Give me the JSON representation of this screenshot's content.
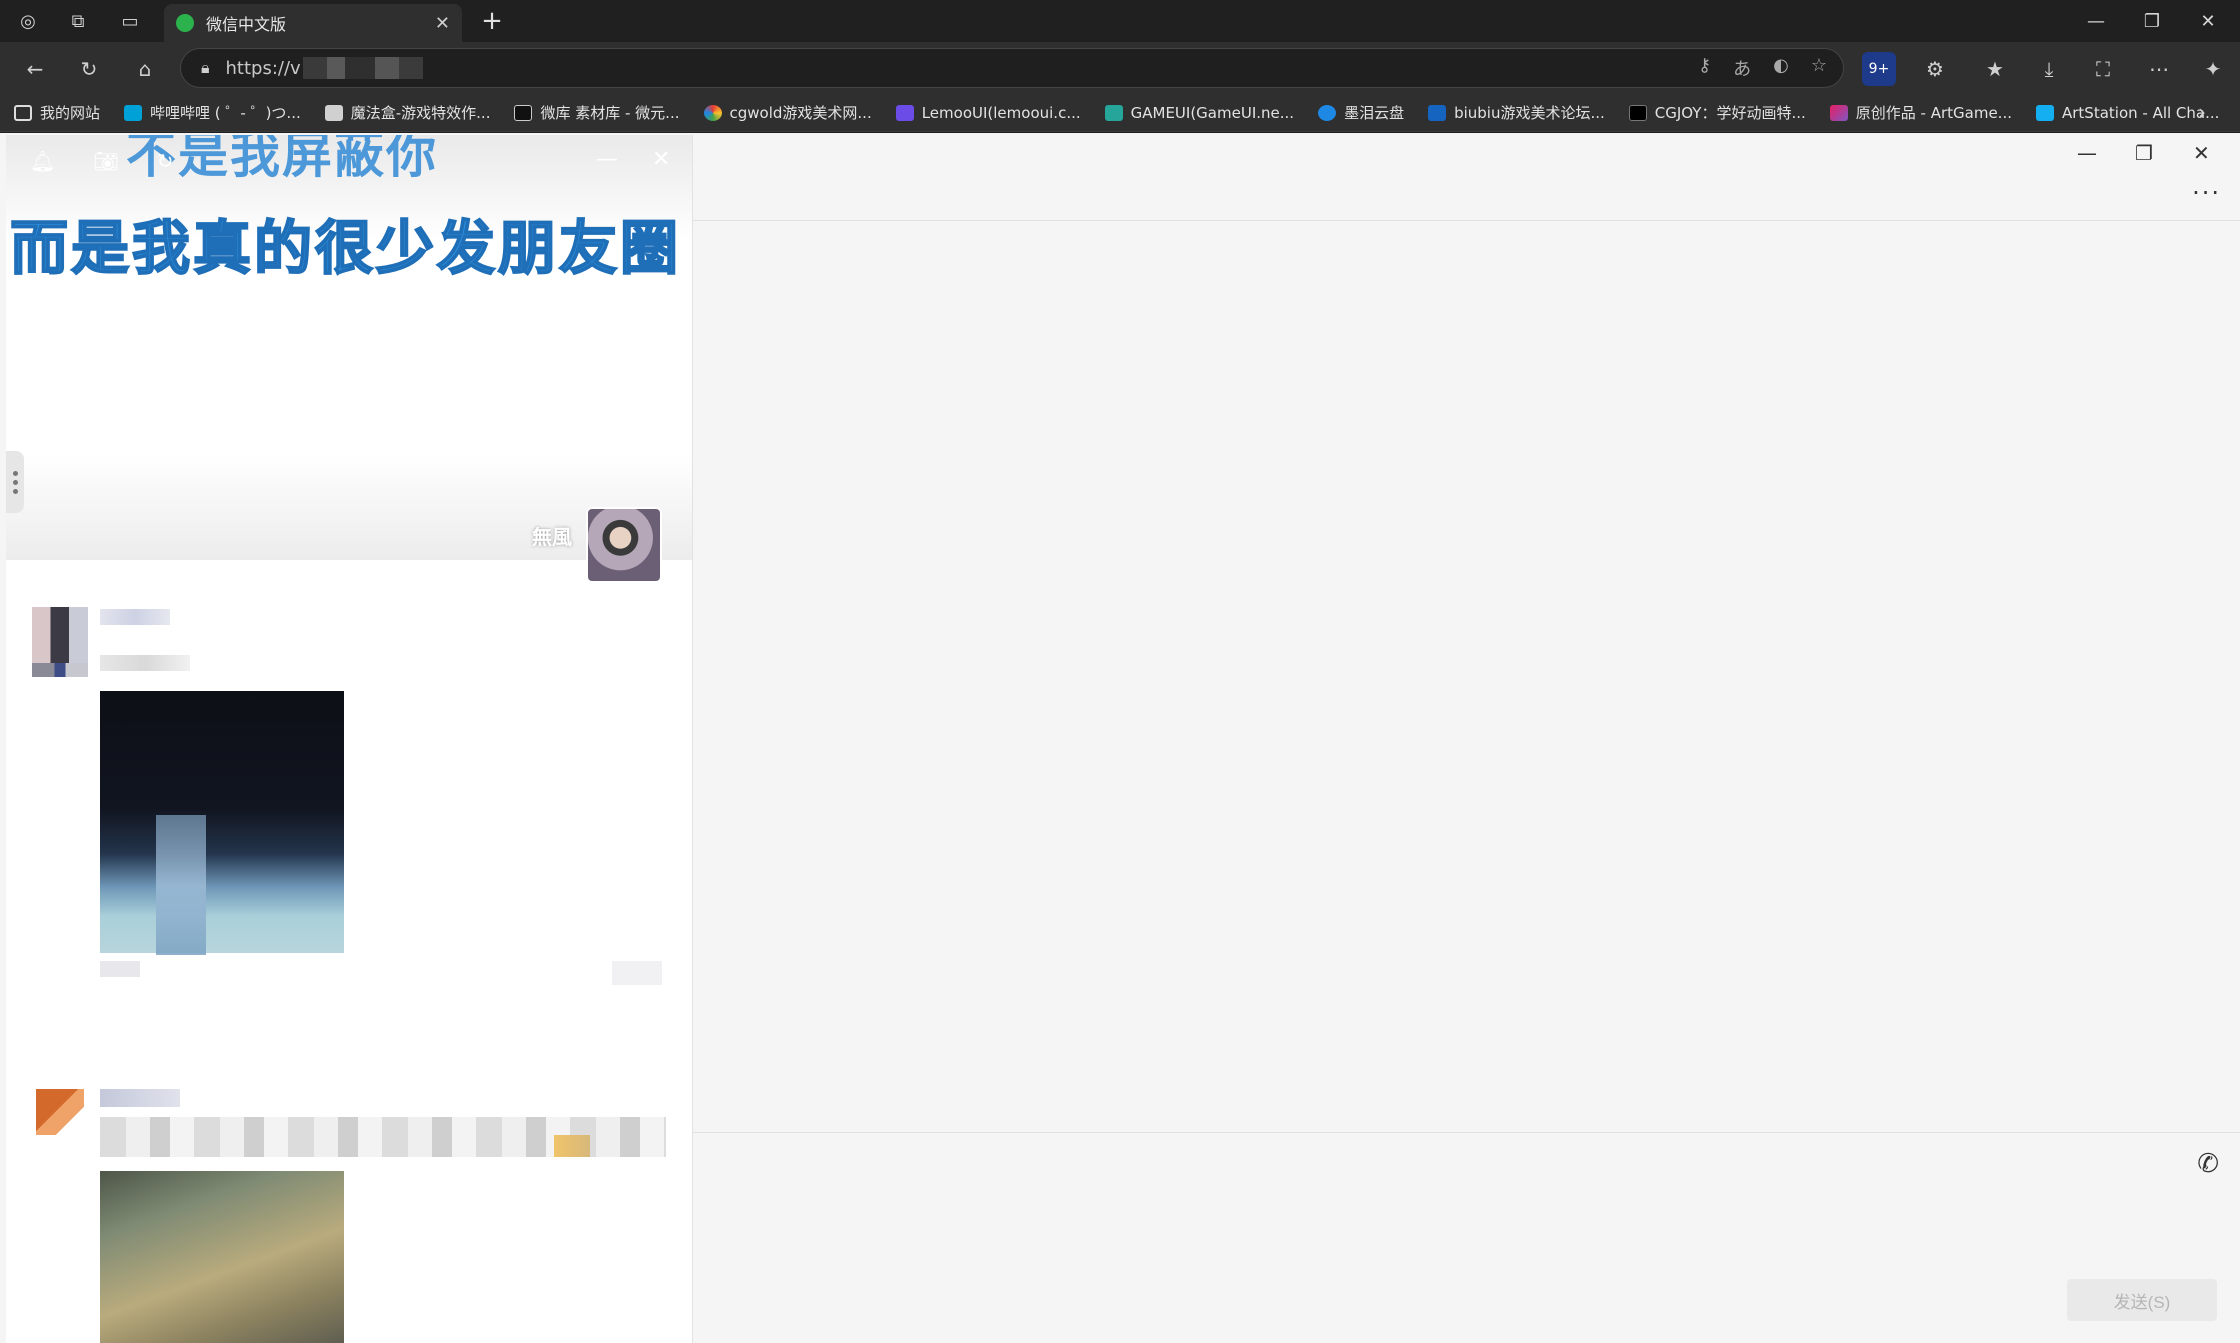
{
  "tab": {
    "title": "微信中文版"
  },
  "address": {
    "url": "https://v"
  },
  "bookmarks": [
    "我的网站",
    "哔哩哔哩 ( ゜- ゜)つ...",
    "魔法盒-游戏特效作...",
    "微库 素材库 - 微元...",
    "cgwold游戏美术网...",
    "LemooUI(lemooui.c...",
    "GAMEUI(GameUI.ne...",
    "墨泪云盘",
    "biubiu游戏美术论坛...",
    "CGJOY：学好动画特...",
    "原创作品 - ArtGame...",
    "ArtStation - All Cha..."
  ],
  "toolbar": {
    "badge": "9+"
  },
  "moments": {
    "cover_line1": "不是我屏蔽你",
    "cover_line2": "而是我真的很少发朋友圈",
    "nickname": "無風"
  },
  "chat": {
    "send_label": "发送(S)"
  },
  "colors": {
    "accent_wechat": "#2bb24c",
    "cover_text": "#2e8fdc"
  }
}
